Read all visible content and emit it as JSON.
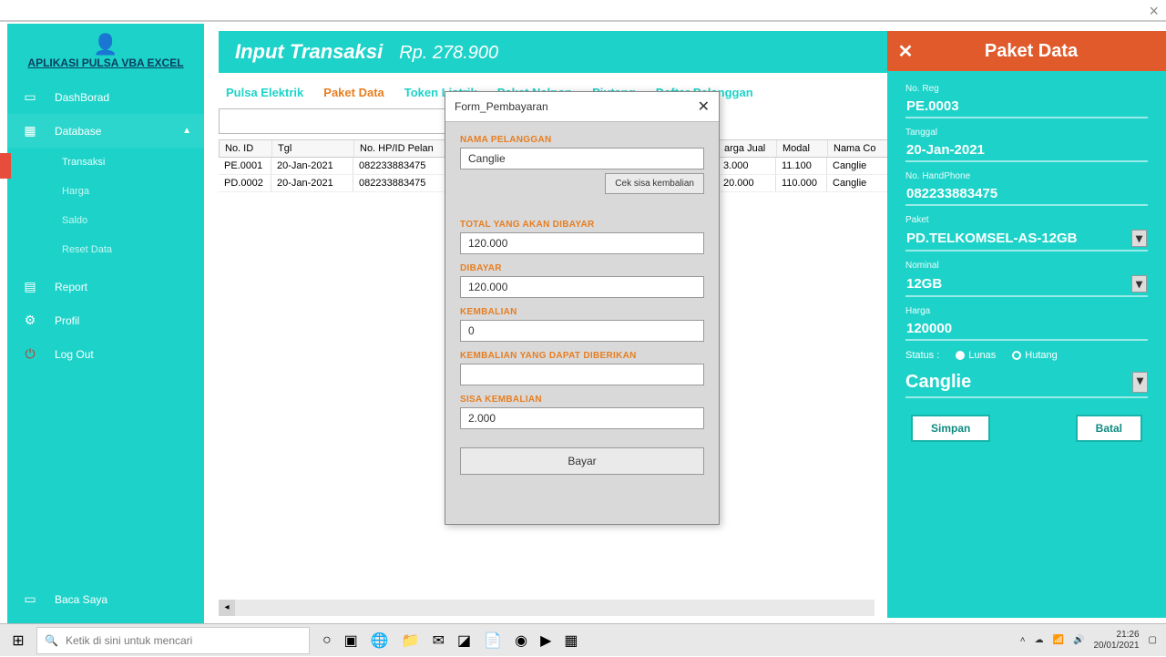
{
  "app": {
    "title": "APLIKASI PULSA VBA EXCEL"
  },
  "sidebar": {
    "dashboard": "DashBorad",
    "database": "Database",
    "transaksi": "Transaksi",
    "harga": "Harga",
    "saldo": "Saldo",
    "reset": "Reset Data",
    "report": "Report",
    "profil": "Profil",
    "logout": "Log Out",
    "baca": "Baca Saya"
  },
  "header": {
    "title": "Input Transaksi",
    "amount": "Rp. 278.900"
  },
  "tabs": {
    "pulsa": "Pulsa Elektrik",
    "paket": "Paket Data",
    "token": "Token Listrik",
    "nelpon": "Paket Nelpon",
    "piutang": "Piutang",
    "daftar": "Daftar Pelanggan"
  },
  "table": {
    "headers": {
      "id": "No. ID",
      "tgl": "Tgl",
      "hp": "No. HP/ID Pelan",
      "hj": "arga Jual",
      "modal": "Modal",
      "nama": "Nama Co"
    },
    "rows": [
      {
        "id": "PE.0001",
        "tgl": "20-Jan-2021",
        "hp": "082233883475",
        "hj": "3.000",
        "modal": "11.100",
        "nama": "Canglie"
      },
      {
        "id": "PD.0002",
        "tgl": "20-Jan-2021",
        "hp": "082233883475",
        "hj": "20.000",
        "modal": "110.000",
        "nama": "Canglie"
      }
    ]
  },
  "modal": {
    "title": "Form_Pembayaran",
    "labels": {
      "nama": "NAMA PELANGGAN",
      "total": "TOTAL YANG AKAN DIBAYAR",
      "dibayar": "DIBAYAR",
      "kembalian": "KEMBALIAN",
      "dapat": "KEMBALIAN YANG DAPAT DIBERIKAN",
      "sisa": "SISA KEMBALIAN"
    },
    "values": {
      "nama": "Canglie",
      "total": "120.000",
      "dibayar": "120.000",
      "kembalian": "0",
      "dapat": "",
      "sisa": "2.000"
    },
    "cek_btn": "Cek sisa kembalian",
    "bayar_btn": "Bayar"
  },
  "panel": {
    "title": "Paket Data",
    "labels": {
      "reg": "No. Reg",
      "tanggal": "Tanggal",
      "hp": "No. HandPhone",
      "paket": "Paket",
      "nominal": "Nominal",
      "harga": "Harga",
      "status": "Status :"
    },
    "values": {
      "reg": "PE.0003",
      "tanggal": "20-Jan-2021",
      "hp": "082233883475",
      "paket": "PD.TELKOMSEL-AS-12GB",
      "nominal": "12GB",
      "harga": "120000",
      "customer": "Canglie"
    },
    "status": {
      "lunas": "Lunas",
      "hutang": "Hutang"
    },
    "simpan": "Simpan",
    "batal": "Batal"
  },
  "taskbar": {
    "search_placeholder": "Ketik di sini untuk mencari",
    "time": "21:26",
    "date": "20/01/2021"
  }
}
